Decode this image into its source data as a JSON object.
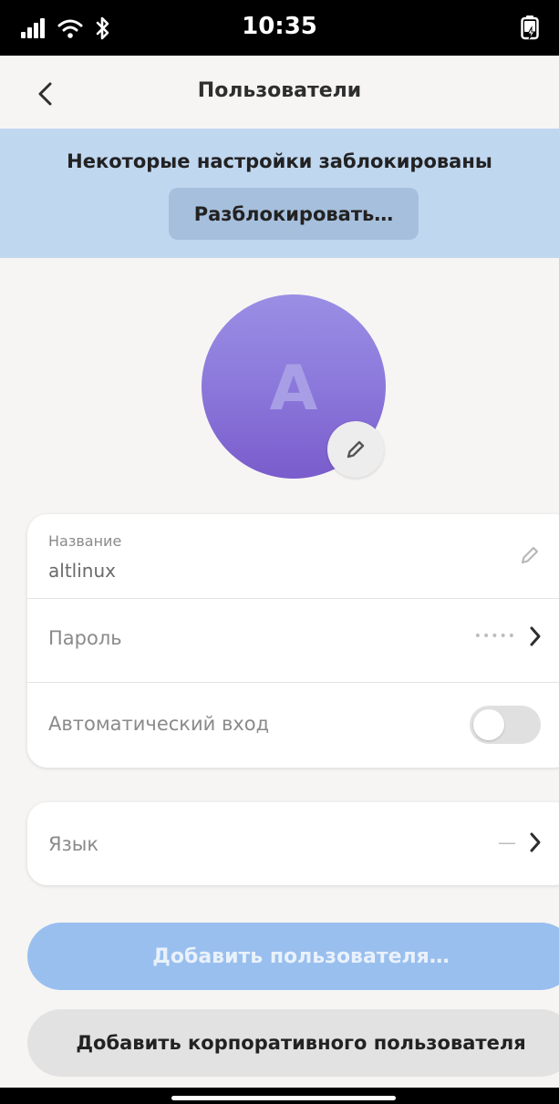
{
  "status_bar": {
    "time": "10:35",
    "icons": [
      "signal-icon",
      "wifi-icon",
      "bluetooth-icon",
      "battery-charging-icon"
    ]
  },
  "header": {
    "title": "Пользователи",
    "back_icon": "chevron-left-icon"
  },
  "banner": {
    "text": "Некоторые настройки заблокированы",
    "button_label": "Разблокировать…",
    "color": "#c0d7f0"
  },
  "avatar": {
    "initial": "A",
    "edit_icon": "pencil-icon",
    "color": "#8d7bdc"
  },
  "account": {
    "name_label": "Название",
    "name_value": "altlinux",
    "password_label": "Пароль",
    "password_value": "•••••",
    "autologin_label": "Автоматический вход",
    "autologin_enabled": false
  },
  "language": {
    "label": "Язык",
    "value": "—"
  },
  "actions": {
    "add_user": "Добавить пользователя…",
    "add_enterprise_user": "Добавить корпоративного пользователя",
    "accent": "#99bfee"
  }
}
